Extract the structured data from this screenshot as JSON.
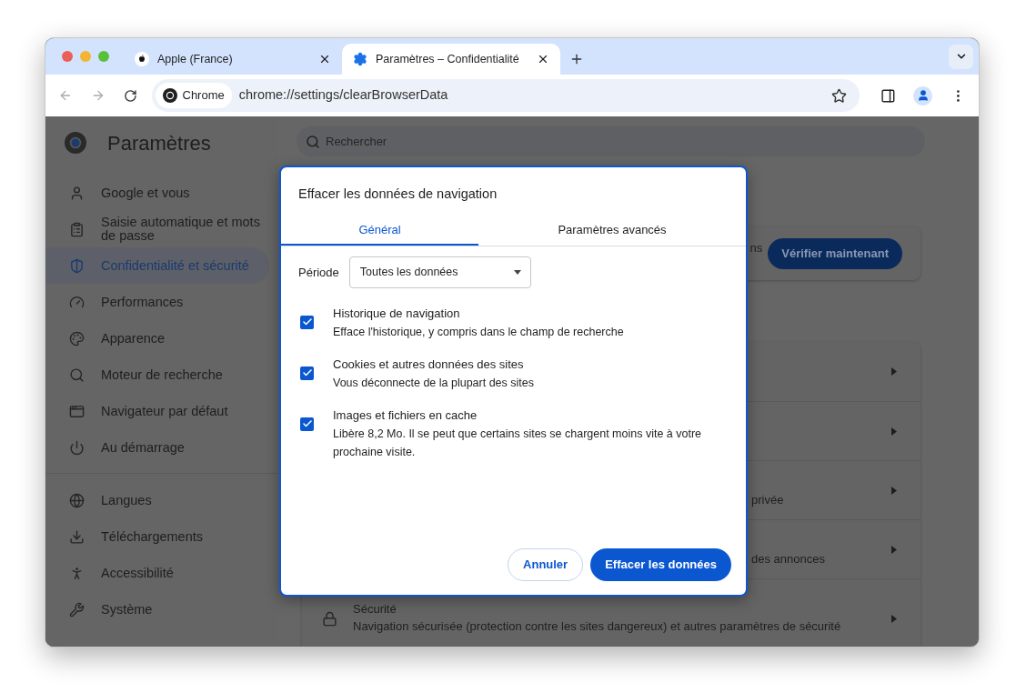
{
  "window": {
    "tabs": [
      {
        "title": "Apple (France)",
        "selected": false,
        "kind": "apple"
      },
      {
        "title": "Paramètres – Confidentialité",
        "selected": true,
        "kind": "settings"
      }
    ],
    "address": {
      "chip": "Chrome",
      "url": "chrome://settings/clearBrowserData"
    }
  },
  "sidebar": {
    "title": "Paramètres",
    "groups": [
      [
        {
          "label": "Google et vous",
          "selected": false
        },
        {
          "label": "Saisie automatique et mots de passe",
          "selected": false
        },
        {
          "label": "Confidentialité et sécurité",
          "selected": true
        },
        {
          "label": "Performances",
          "selected": false
        },
        {
          "label": "Apparence",
          "selected": false
        },
        {
          "label": "Moteur de recherche",
          "selected": false
        },
        {
          "label": "Navigateur par défaut",
          "selected": false
        },
        {
          "label": "Au démarrage",
          "selected": false
        }
      ],
      [
        {
          "label": "Langues",
          "selected": false
        },
        {
          "label": "Téléchargements",
          "selected": false
        },
        {
          "label": "Accessibilité",
          "selected": false
        },
        {
          "label": "Système",
          "selected": false
        }
      ]
    ]
  },
  "main": {
    "search": {
      "placeholder": "Rechercher"
    },
    "safety_card": {
      "text": "ns",
      "button": "Vérifier maintenant"
    },
    "rows": [
      {},
      {},
      {
        "text": "privée"
      },
      {
        "text": "des annonces"
      },
      {
        "title": "Sécurité",
        "text": "Navigation sécurisée (protection contre les sites dangereux) et autres paramètres de sécurité"
      }
    ]
  },
  "dialog": {
    "title": "Effacer les données de navigation",
    "tabs": [
      {
        "label": "Général",
        "selected": true
      },
      {
        "label": "Paramètres avancés",
        "selected": false
      }
    ],
    "period": {
      "label": "Période",
      "value": "Toutes les données"
    },
    "options": [
      {
        "title": "Historique de navigation",
        "description": "Efface l'historique, y compris dans le champ de recherche",
        "checked": true
      },
      {
        "title": "Cookies et autres données des sites",
        "description": "Vous déconnecte de la plupart des sites",
        "checked": true
      },
      {
        "title": "Images et fichiers en cache",
        "description": "Libère 8,2 Mo. Il se peut que certains sites se chargent moins vite à votre prochaine visite.",
        "checked": true
      }
    ],
    "buttons": [
      {
        "label": "Annuler",
        "kind": "secondary"
      },
      {
        "label": "Effacer les données",
        "kind": "primary"
      }
    ]
  }
}
